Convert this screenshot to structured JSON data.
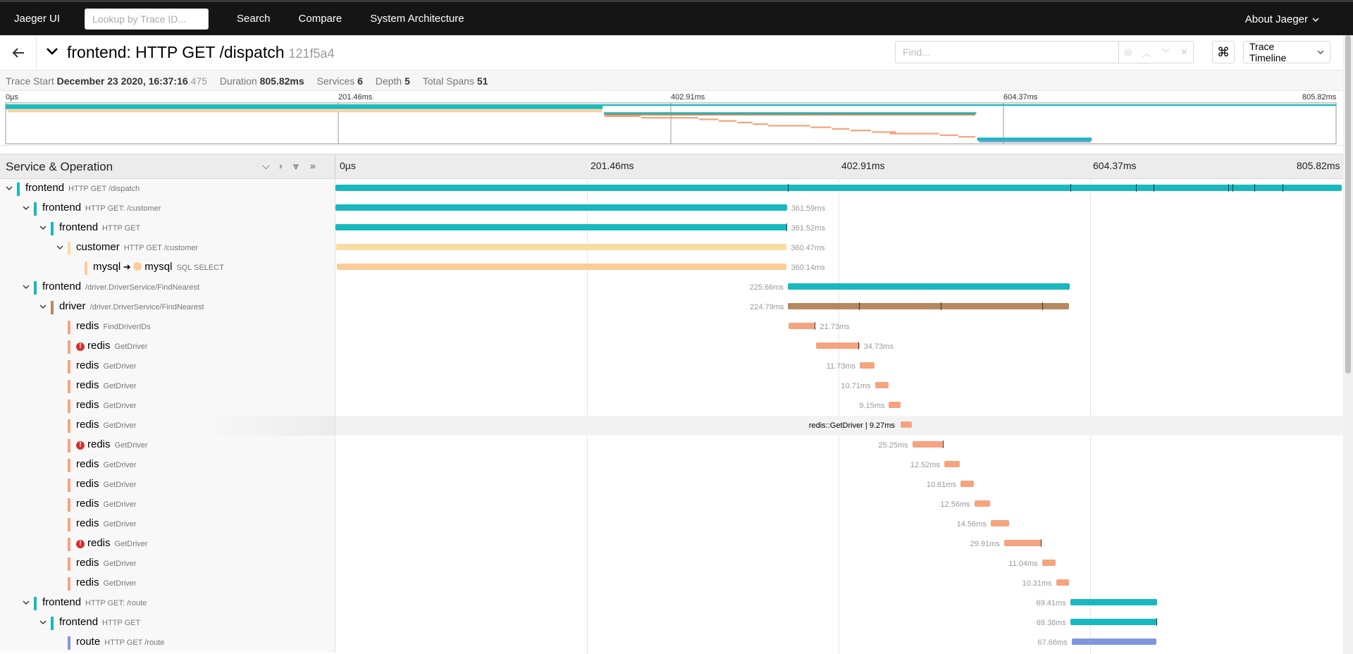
{
  "nav": {
    "brand": "Jaeger UI",
    "lookup_placeholder": "Lookup by Trace ID...",
    "links": [
      "Search",
      "Compare",
      "System Architecture"
    ],
    "about": "About Jaeger"
  },
  "trace": {
    "title": "frontend: HTTP GET /dispatch",
    "id": "121f5a4",
    "find_placeholder": "Find...",
    "view_mode": "Trace Timeline"
  },
  "summary": {
    "start_label": "Trace Start",
    "start_value": "December 23 2020, 16:37:16",
    "start_ms": ".475",
    "duration_label": "Duration",
    "duration_value": "805.82ms",
    "services_label": "Services",
    "services_value": "6",
    "depth_label": "Depth",
    "depth_value": "5",
    "spans_label": "Total Spans",
    "spans_value": "51"
  },
  "ticks": [
    "0µs",
    "201.46ms",
    "402.91ms",
    "604.37ms",
    "805.82ms"
  ],
  "header_title": "Service & Operation",
  "hover_label": "redis::GetDriver | 9.27ms",
  "colors": {
    "frontend": "#17B8BE",
    "customer": "#F8DCA1",
    "mysql": "#FFCB99",
    "driver": "#B7885E",
    "redis": "#F5A47F",
    "route": "#8296DE",
    "error": "#D32F2F"
  },
  "spans": [
    {
      "depth": 0,
      "toggle": true,
      "service": "frontend",
      "op": "HTTP GET /dispatch",
      "color": "frontend",
      "start": 0,
      "duration": 805.82,
      "label": "",
      "error": false,
      "ticks": [
        362.1,
        588.4,
        641.2,
        655.0,
        715.0,
        718.3,
        736.0,
        758.5
      ]
    },
    {
      "depth": 1,
      "toggle": true,
      "service": "frontend",
      "op": "HTTP GET: /customer",
      "color": "frontend",
      "start": 0,
      "duration": 361.59,
      "label": "361.59ms",
      "error": false,
      "ticks": []
    },
    {
      "depth": 2,
      "toggle": true,
      "service": "frontend",
      "op": "HTTP GET",
      "color": "frontend",
      "start": 0,
      "duration": 361.52,
      "label": "361.52ms",
      "error": false,
      "ticks": [
        360.9
      ]
    },
    {
      "depth": 3,
      "toggle": true,
      "service": "customer",
      "op": "HTTP GET /customer",
      "color": "customer",
      "start": 0.8,
      "duration": 360.47,
      "label": "360.47ms",
      "error": false,
      "ticks": []
    },
    {
      "depth": 4,
      "toggle": false,
      "service": "mysql",
      "peer": "mysql",
      "op": "SQL SELECT",
      "color": "mysql",
      "start": 1.2,
      "duration": 360.14,
      "label": "360.14ms",
      "error": false,
      "ticks": []
    },
    {
      "depth": 1,
      "toggle": true,
      "service": "frontend",
      "op": "/driver.DriverService/FindNearest",
      "color": "frontend",
      "start": 362.3,
      "duration": 225.66,
      "label": "225.66ms",
      "label_left": true,
      "error": false,
      "ticks": []
    },
    {
      "depth": 2,
      "toggle": true,
      "service": "driver",
      "op": "/driver.DriverService/FindNearest",
      "color": "driver",
      "start": 362.5,
      "duration": 224.79,
      "label": "224.79ms",
      "label_left": true,
      "error": false,
      "ticks": [
        419.0,
        485.0,
        566.0
      ]
    },
    {
      "depth": 3,
      "toggle": false,
      "service": "redis",
      "op": "FindDriverIDs",
      "color": "redis",
      "start": 362.8,
      "duration": 21.73,
      "label": "21.73ms",
      "error": false,
      "ticks": [
        383.9
      ]
    },
    {
      "depth": 3,
      "toggle": false,
      "service": "redis",
      "op": "GetDriver",
      "color": "redis",
      "start": 384.9,
      "duration": 34.73,
      "label": "34.73ms",
      "error": true,
      "ticks": [
        418.9
      ]
    },
    {
      "depth": 3,
      "toggle": false,
      "service": "redis",
      "op": "GetDriver",
      "color": "redis",
      "start": 419.9,
      "duration": 11.73,
      "label": "11.73ms",
      "label_left": true,
      "error": false,
      "ticks": []
    },
    {
      "depth": 3,
      "toggle": false,
      "service": "redis",
      "op": "GetDriver",
      "color": "redis",
      "start": 432.0,
      "duration": 10.71,
      "label": "10.71ms",
      "label_left": true,
      "error": false,
      "ticks": []
    },
    {
      "depth": 3,
      "toggle": false,
      "service": "redis",
      "op": "GetDriver",
      "color": "redis",
      "start": 443.2,
      "duration": 9.15,
      "label": "9.15ms",
      "label_left": true,
      "error": false,
      "ticks": []
    },
    {
      "depth": 3,
      "toggle": false,
      "service": "redis",
      "op": "GetDriver",
      "color": "redis",
      "start": 452.5,
      "duration": 9.27,
      "label": "",
      "error": false,
      "hover": true,
      "ticks": []
    },
    {
      "depth": 3,
      "toggle": false,
      "service": "redis",
      "op": "GetDriver",
      "color": "redis",
      "start": 461.9,
      "duration": 25.25,
      "label": "25.25ms",
      "label_left": true,
      "error": true,
      "ticks": [
        486.5
      ]
    },
    {
      "depth": 3,
      "toggle": false,
      "service": "redis",
      "op": "GetDriver",
      "color": "redis",
      "start": 487.5,
      "duration": 12.52,
      "label": "12.52ms",
      "label_left": true,
      "error": false,
      "ticks": []
    },
    {
      "depth": 3,
      "toggle": false,
      "service": "redis",
      "op": "GetDriver",
      "color": "redis",
      "start": 500.5,
      "duration": 10.61,
      "label": "10.61ms",
      "label_left": true,
      "error": false,
      "ticks": []
    },
    {
      "depth": 3,
      "toggle": false,
      "service": "redis",
      "op": "GetDriver",
      "color": "redis",
      "start": 511.6,
      "duration": 12.56,
      "label": "12.56ms",
      "label_left": true,
      "error": false,
      "ticks": []
    },
    {
      "depth": 3,
      "toggle": false,
      "service": "redis",
      "op": "GetDriver",
      "color": "redis",
      "start": 524.7,
      "duration": 14.56,
      "label": "14.56ms",
      "label_left": true,
      "error": false,
      "ticks": []
    },
    {
      "depth": 3,
      "toggle": false,
      "service": "redis",
      "op": "GetDriver",
      "color": "redis",
      "start": 535.4,
      "duration": 29.91,
      "label": "29.91ms",
      "label_left": true,
      "error": true,
      "ticks": [
        565.0
      ]
    },
    {
      "depth": 3,
      "toggle": false,
      "service": "redis",
      "op": "GetDriver",
      "color": "redis",
      "start": 565.8,
      "duration": 11.04,
      "label": "11.04ms",
      "label_left": true,
      "error": false,
      "ticks": []
    },
    {
      "depth": 3,
      "toggle": false,
      "service": "redis",
      "op": "GetDriver",
      "color": "redis",
      "start": 577.1,
      "duration": 10.31,
      "label": "10.31ms",
      "label_left": true,
      "error": false,
      "ticks": []
    },
    {
      "depth": 1,
      "toggle": true,
      "service": "frontend",
      "op": "HTTP GET: /route",
      "color": "frontend",
      "start": 588.4,
      "duration": 69.41,
      "label": "69.41ms",
      "label_left": true,
      "error": false,
      "ticks": []
    },
    {
      "depth": 2,
      "toggle": true,
      "service": "frontend",
      "op": "HTTP GET",
      "color": "frontend",
      "start": 588.5,
      "duration": 69.38,
      "label": "69.38ms",
      "label_left": true,
      "error": false,
      "ticks": [
        657.6
      ]
    },
    {
      "depth": 3,
      "toggle": false,
      "service": "route",
      "op": "HTTP GET /route",
      "color": "route",
      "start": 589.5,
      "duration": 67.66,
      "label": "67.66ms",
      "label_left": true,
      "error": false,
      "ticks": []
    }
  ]
}
